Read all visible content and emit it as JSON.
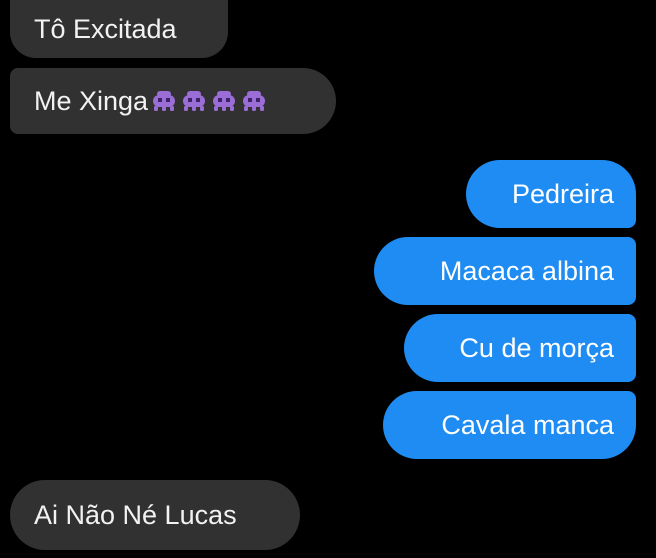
{
  "messages": {
    "incoming": [
      {
        "text": "Tô Excitada"
      },
      {
        "text": "Me Xinga",
        "emojis": [
          "alien-monster-icon",
          "alien-monster-icon",
          "alien-monster-icon",
          "alien-monster-icon"
        ]
      },
      {
        "text": "Ai Não Né Lucas"
      }
    ],
    "outgoing": [
      {
        "text": "Pedreira"
      },
      {
        "text": "Macaca albina"
      },
      {
        "text": "Cu de morça"
      },
      {
        "text": "Cavala manca"
      }
    ]
  },
  "colors": {
    "background": "#000000",
    "incoming_bubble": "#313131",
    "outgoing_bubble": "#1e8cf2",
    "emoji": "#9b6dd6"
  }
}
